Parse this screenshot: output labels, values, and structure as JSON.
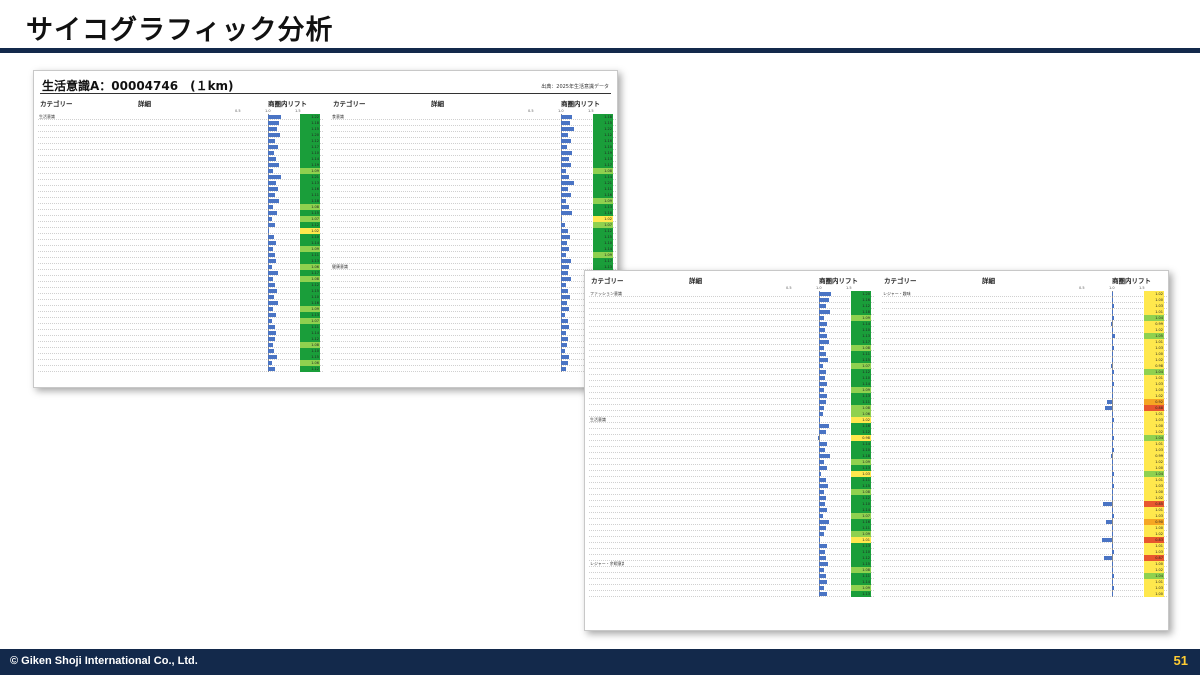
{
  "slide": {
    "title": "サイコグラフィック分析",
    "footer_copyright": "© Giken Shoji International Co., Ltd.",
    "page_number": "51"
  },
  "colors": {
    "navy": "#13294b",
    "bar": "#4a74c4",
    "lift_high": "#1a9e3a",
    "lift_mid": "#8fd14f",
    "lift_neutral": "#ffe84d",
    "lift_low": "#f5a623",
    "lift_lowest": "#e8572e"
  },
  "panels": [
    {
      "title": "生活意識A：00004746　(１km)",
      "source": "出典：2025年生活意識データ",
      "halves": [
        {
          "headers": {
            "category": "カテゴリー",
            "detail": "詳細",
            "lift": "商圏内リフト"
          },
          "scale": [
            "0.5",
            "1.0",
            "1.5"
          ],
          "rows": [
            {
              "cat": "生活意識",
              "lift": 1.22
            },
            {
              "cat": "",
              "lift": 1.18
            },
            {
              "cat": "",
              "lift": 1.15
            },
            {
              "cat": "",
              "lift": 1.2
            },
            {
              "cat": "",
              "lift": 1.12
            },
            {
              "cat": "",
              "lift": 1.17
            },
            {
              "cat": "",
              "lift": 1.1
            },
            {
              "cat": "",
              "lift": 1.14
            },
            {
              "cat": "",
              "lift": 1.19
            },
            {
              "cat": "",
              "lift": 1.09
            },
            {
              "cat": "",
              "lift": 1.21
            },
            {
              "cat": "",
              "lift": 1.13
            },
            {
              "cat": "",
              "lift": 1.16
            },
            {
              "cat": "",
              "lift": 1.11
            },
            {
              "cat": "",
              "lift": 1.18
            },
            {
              "cat": "",
              "lift": 1.08
            },
            {
              "cat": "",
              "lift": 1.15
            },
            {
              "cat": "",
              "lift": 1.07
            },
            {
              "cat": "",
              "lift": 1.12
            },
            {
              "cat": "",
              "lift": 1.02
            },
            {
              "cat": "",
              "lift": 1.1
            },
            {
              "cat": "",
              "lift": 1.14
            },
            {
              "cat": "",
              "lift": 1.09
            },
            {
              "cat": "",
              "lift": 1.11
            },
            {
              "cat": "",
              "lift": 1.13
            },
            {
              "cat": "",
              "lift": 1.06
            },
            {
              "cat": "",
              "lift": 1.17
            },
            {
              "cat": "",
              "lift": 1.08
            },
            {
              "cat": "",
              "lift": 1.12
            },
            {
              "cat": "",
              "lift": 1.15
            },
            {
              "cat": "",
              "lift": 1.1
            },
            {
              "cat": "",
              "lift": 1.16
            },
            {
              "cat": "",
              "lift": 1.09
            },
            {
              "cat": "",
              "lift": 1.13
            },
            {
              "cat": "",
              "lift": 1.07
            },
            {
              "cat": "",
              "lift": 1.11
            },
            {
              "cat": "",
              "lift": 1.14
            },
            {
              "cat": "",
              "lift": 1.12
            },
            {
              "cat": "",
              "lift": 1.08
            },
            {
              "cat": "",
              "lift": 1.1
            },
            {
              "cat": "",
              "lift": 1.15
            },
            {
              "cat": "",
              "lift": 1.06
            },
            {
              "cat": "",
              "lift": 1.12
            }
          ]
        },
        {
          "headers": {
            "category": "カテゴリー",
            "detail": "詳細",
            "lift": "商圏内リフト"
          },
          "scale": [
            "0.5",
            "1.0",
            "1.5"
          ],
          "rows": [
            {
              "cat": "食意識",
              "lift": 1.18
            },
            {
              "cat": "",
              "lift": 1.15
            },
            {
              "cat": "",
              "lift": 1.22
            },
            {
              "cat": "",
              "lift": 1.12
            },
            {
              "cat": "",
              "lift": 1.16
            },
            {
              "cat": "",
              "lift": 1.1
            },
            {
              "cat": "",
              "lift": 1.19
            },
            {
              "cat": "",
              "lift": 1.13
            },
            {
              "cat": "",
              "lift": 1.17
            },
            {
              "cat": "",
              "lift": 1.08
            },
            {
              "cat": "",
              "lift": 1.14
            },
            {
              "cat": "",
              "lift": 1.21
            },
            {
              "cat": "",
              "lift": 1.11
            },
            {
              "cat": "",
              "lift": 1.16
            },
            {
              "cat": "",
              "lift": 1.09
            },
            {
              "cat": "",
              "lift": 1.13
            },
            {
              "cat": "",
              "lift": 1.18
            },
            {
              "cat": "",
              "lift": 1.02
            },
            {
              "cat": "",
              "lift": 1.07
            },
            {
              "cat": "",
              "lift": 1.12
            },
            {
              "cat": "",
              "lift": 1.15
            },
            {
              "cat": "",
              "lift": 1.1
            },
            {
              "cat": "",
              "lift": 1.14
            },
            {
              "cat": "",
              "lift": 1.09
            },
            {
              "cat": "",
              "lift": 1.17
            },
            {
              "cat": "健康意識",
              "lift": 1.13
            },
            {
              "cat": "",
              "lift": 1.11
            },
            {
              "cat": "",
              "lift": 1.16
            },
            {
              "cat": "",
              "lift": 1.08
            },
            {
              "cat": "",
              "lift": 1.12
            },
            {
              "cat": "",
              "lift": 1.15
            },
            {
              "cat": "",
              "lift": 1.1
            },
            {
              "cat": "",
              "lift": 1.14
            },
            {
              "cat": "",
              "lift": 1.06
            },
            {
              "cat": "",
              "lift": 1.11
            },
            {
              "cat": "",
              "lift": 1.13
            },
            {
              "cat": "",
              "lift": 1.09
            },
            {
              "cat": "",
              "lift": 1.12
            },
            {
              "cat": "",
              "lift": 1.1
            },
            {
              "cat": "",
              "lift": 1.07
            },
            {
              "cat": "",
              "lift": 1.14
            },
            {
              "cat": "",
              "lift": 1.11
            },
            {
              "cat": "",
              "lift": 1.08
            }
          ]
        }
      ]
    },
    {
      "title": "",
      "source": "",
      "halves": [
        {
          "headers": {
            "category": "カテゴリー",
            "detail": "詳細",
            "lift": "商圏内リフト"
          },
          "scale": [
            "0.5",
            "1.0",
            "1.5"
          ],
          "rows": [
            {
              "cat": "ファッション意識",
              "lift": 1.2
            },
            {
              "cat": "",
              "lift": 1.16
            },
            {
              "cat": "",
              "lift": 1.12
            },
            {
              "cat": "",
              "lift": 1.18
            },
            {
              "cat": "",
              "lift": 1.09
            },
            {
              "cat": "",
              "lift": 1.14
            },
            {
              "cat": "",
              "lift": 1.1
            },
            {
              "cat": "",
              "lift": 1.13
            },
            {
              "cat": "",
              "lift": 1.17
            },
            {
              "cat": "",
              "lift": 1.08
            },
            {
              "cat": "",
              "lift": 1.11
            },
            {
              "cat": "",
              "lift": 1.15
            },
            {
              "cat": "",
              "lift": 1.07
            },
            {
              "cat": "",
              "lift": 1.12
            },
            {
              "cat": "",
              "lift": 1.1
            },
            {
              "cat": "",
              "lift": 1.14
            },
            {
              "cat": "",
              "lift": 1.09
            },
            {
              "cat": "",
              "lift": 1.13
            },
            {
              "cat": "",
              "lift": 1.11
            },
            {
              "cat": "",
              "lift": 1.08
            },
            {
              "cat": "",
              "lift": 1.06
            },
            {
              "cat": "生活意識",
              "lift": 1.02
            },
            {
              "cat": "",
              "lift": 1.16
            },
            {
              "cat": "",
              "lift": 1.12
            },
            {
              "cat": "",
              "lift": 0.98
            },
            {
              "cat": "",
              "lift": 1.14
            },
            {
              "cat": "",
              "lift": 1.1
            },
            {
              "cat": "",
              "lift": 1.18
            },
            {
              "cat": "",
              "lift": 1.09
            },
            {
              "cat": "",
              "lift": 1.13
            },
            {
              "cat": "",
              "lift": 1.03
            },
            {
              "cat": "",
              "lift": 1.11
            },
            {
              "cat": "",
              "lift": 1.15
            },
            {
              "cat": "",
              "lift": 1.08
            },
            {
              "cat": "",
              "lift": 1.12
            },
            {
              "cat": "",
              "lift": 1.1
            },
            {
              "cat": "",
              "lift": 1.14
            },
            {
              "cat": "",
              "lift": 1.07
            },
            {
              "cat": "",
              "lift": 1.16
            },
            {
              "cat": "",
              "lift": 1.11
            },
            {
              "cat": "",
              "lift": 1.09
            },
            {
              "cat": "",
              "lift": 1.01
            },
            {
              "cat": "",
              "lift": 1.13
            },
            {
              "cat": "",
              "lift": 1.1
            },
            {
              "cat": "",
              "lift": 1.12
            },
            {
              "cat": "レジャー・余暇意識",
              "lift": 1.15
            },
            {
              "cat": "",
              "lift": 1.08
            },
            {
              "cat": "",
              "lift": 1.11
            },
            {
              "cat": "",
              "lift": 1.14
            },
            {
              "cat": "",
              "lift": 1.09
            },
            {
              "cat": "",
              "lift": 1.13
            }
          ]
        },
        {
          "headers": {
            "category": "カテゴリー",
            "detail": "詳細",
            "lift": "商圏内リフト"
          },
          "scale": [
            "0.5",
            "1.0",
            "1.5"
          ],
          "rows": [
            {
              "cat": "レジャー・趣味",
              "lift": 1.02
            },
            {
              "cat": "",
              "lift": 1.0
            },
            {
              "cat": "",
              "lift": 1.03
            },
            {
              "cat": "",
              "lift": 1.01
            },
            {
              "cat": "",
              "lift": 1.04
            },
            {
              "cat": "",
              "lift": 0.99
            },
            {
              "cat": "",
              "lift": 1.02
            },
            {
              "cat": "",
              "lift": 1.05
            },
            {
              "cat": "",
              "lift": 1.01
            },
            {
              "cat": "",
              "lift": 1.03
            },
            {
              "cat": "",
              "lift": 1.0
            },
            {
              "cat": "",
              "lift": 1.02
            },
            {
              "cat": "",
              "lift": 0.98
            },
            {
              "cat": "",
              "lift": 1.04
            },
            {
              "cat": "",
              "lift": 1.01
            },
            {
              "cat": "",
              "lift": 1.03
            },
            {
              "cat": "",
              "lift": 1.0
            },
            {
              "cat": "",
              "lift": 1.02
            },
            {
              "cat": "",
              "lift": 0.92
            },
            {
              "cat": "",
              "lift": 0.88
            },
            {
              "cat": "",
              "lift": 1.01
            },
            {
              "cat": "",
              "lift": 1.03
            },
            {
              "cat": "",
              "lift": 1.0
            },
            {
              "cat": "",
              "lift": 1.02
            },
            {
              "cat": "",
              "lift": 1.04
            },
            {
              "cat": "",
              "lift": 1.01
            },
            {
              "cat": "",
              "lift": 1.03
            },
            {
              "cat": "",
              "lift": 0.99
            },
            {
              "cat": "",
              "lift": 1.02
            },
            {
              "cat": "",
              "lift": 1.0
            },
            {
              "cat": "",
              "lift": 1.04
            },
            {
              "cat": "",
              "lift": 1.01
            },
            {
              "cat": "",
              "lift": 1.03
            },
            {
              "cat": "",
              "lift": 1.0
            },
            {
              "cat": "",
              "lift": 1.02
            },
            {
              "cat": "",
              "lift": 0.85
            },
            {
              "cat": "",
              "lift": 1.01
            },
            {
              "cat": "",
              "lift": 1.03
            },
            {
              "cat": "",
              "lift": 0.9
            },
            {
              "cat": "",
              "lift": 1.0
            },
            {
              "cat": "",
              "lift": 1.02
            },
            {
              "cat": "",
              "lift": 0.83
            },
            {
              "cat": "",
              "lift": 1.01
            },
            {
              "cat": "",
              "lift": 1.03
            },
            {
              "cat": "",
              "lift": 0.87
            },
            {
              "cat": "",
              "lift": 1.0
            },
            {
              "cat": "",
              "lift": 1.02
            },
            {
              "cat": "",
              "lift": 1.04
            },
            {
              "cat": "",
              "lift": 1.01
            },
            {
              "cat": "",
              "lift": 1.03
            },
            {
              "cat": "",
              "lift": 1.0
            }
          ]
        }
      ]
    }
  ]
}
